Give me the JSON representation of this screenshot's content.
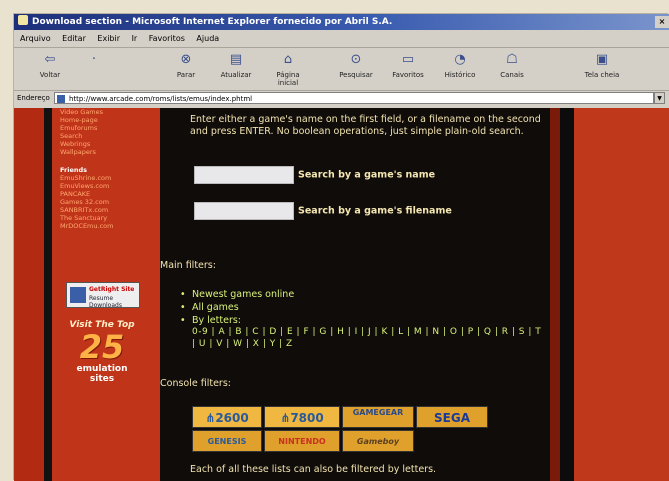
{
  "window": {
    "title": "Download section - Microsoft Internet Explorer fornecido por Abril S.A."
  },
  "menu": [
    "Arquivo",
    "Editar",
    "Exibir",
    "Ir",
    "Favoritos",
    "Ajuda"
  ],
  "toolbar": [
    {
      "label": "Voltar",
      "icon": "back-arrow-icon"
    },
    {
      "label": "",
      "icon": "forward-arrow-icon"
    },
    {
      "label": "Parar",
      "icon": "stop-icon"
    },
    {
      "label": "Atualizar",
      "icon": "refresh-icon"
    },
    {
      "label": "Página inicial",
      "icon": "home-icon"
    },
    {
      "label": "Pesquisar",
      "icon": "search-icon"
    },
    {
      "label": "Favoritos",
      "icon": "favorites-icon"
    },
    {
      "label": "Histórico",
      "icon": "history-icon"
    },
    {
      "label": "Canais",
      "icon": "channels-icon"
    },
    {
      "label": "Tela cheia",
      "icon": "fullscreen-icon"
    }
  ],
  "address": {
    "label": "Endereço",
    "url": "http://www.arcade.com/roms/lists/emus/index.phtml"
  },
  "sidebar": {
    "nav": [
      "Video Games",
      "Home-page",
      "Emuforums",
      "Search",
      "Webrings",
      "Wallpapers"
    ],
    "friends_heading": "Friends",
    "friends": [
      "EmuShrine.com",
      "EmuViews.com",
      "PANCAKE",
      "Games 32.com",
      "SANBRITx.com",
      "The Sanctuary",
      "MrDOCEmu.com"
    ],
    "banner": {
      "line1": "GetRight Site",
      "line2": "Resume Downloads"
    },
    "top25": {
      "line1": "Visit The Top",
      "number": "25",
      "line2": "emulation",
      "line3": "sites"
    }
  },
  "main": {
    "intro": "Enter either a game's name on the first field, or a filename on the second and press ENTER. No boolean operations, just simple plain-old search.",
    "search_name_label": "Search by a game's name",
    "search_file_label": "Search by a game's filename",
    "main_filters_heading": "Main filters:",
    "filters": [
      "Newest games online",
      "All games",
      "By letters:"
    ],
    "letters": "0-9 | A | B | C | D | E | F | G | H | I | J | K | L | M | N | O | P | Q | R | S | T | U | V | W | X | Y | Z",
    "console_filters_heading": "Console filters:",
    "consoles": [
      "2600",
      "7800",
      "GAMEGEAR",
      "SEGA",
      "GENESIS",
      "NINTENDO",
      "Gameboy"
    ],
    "footer": "Each of all these lists can also be filtered by letters."
  },
  "colors": {
    "page_red": "#b32a12",
    "main_bg": "#100c0a",
    "main_text": "#f2e4b0",
    "link_green": "#d9f27a"
  }
}
